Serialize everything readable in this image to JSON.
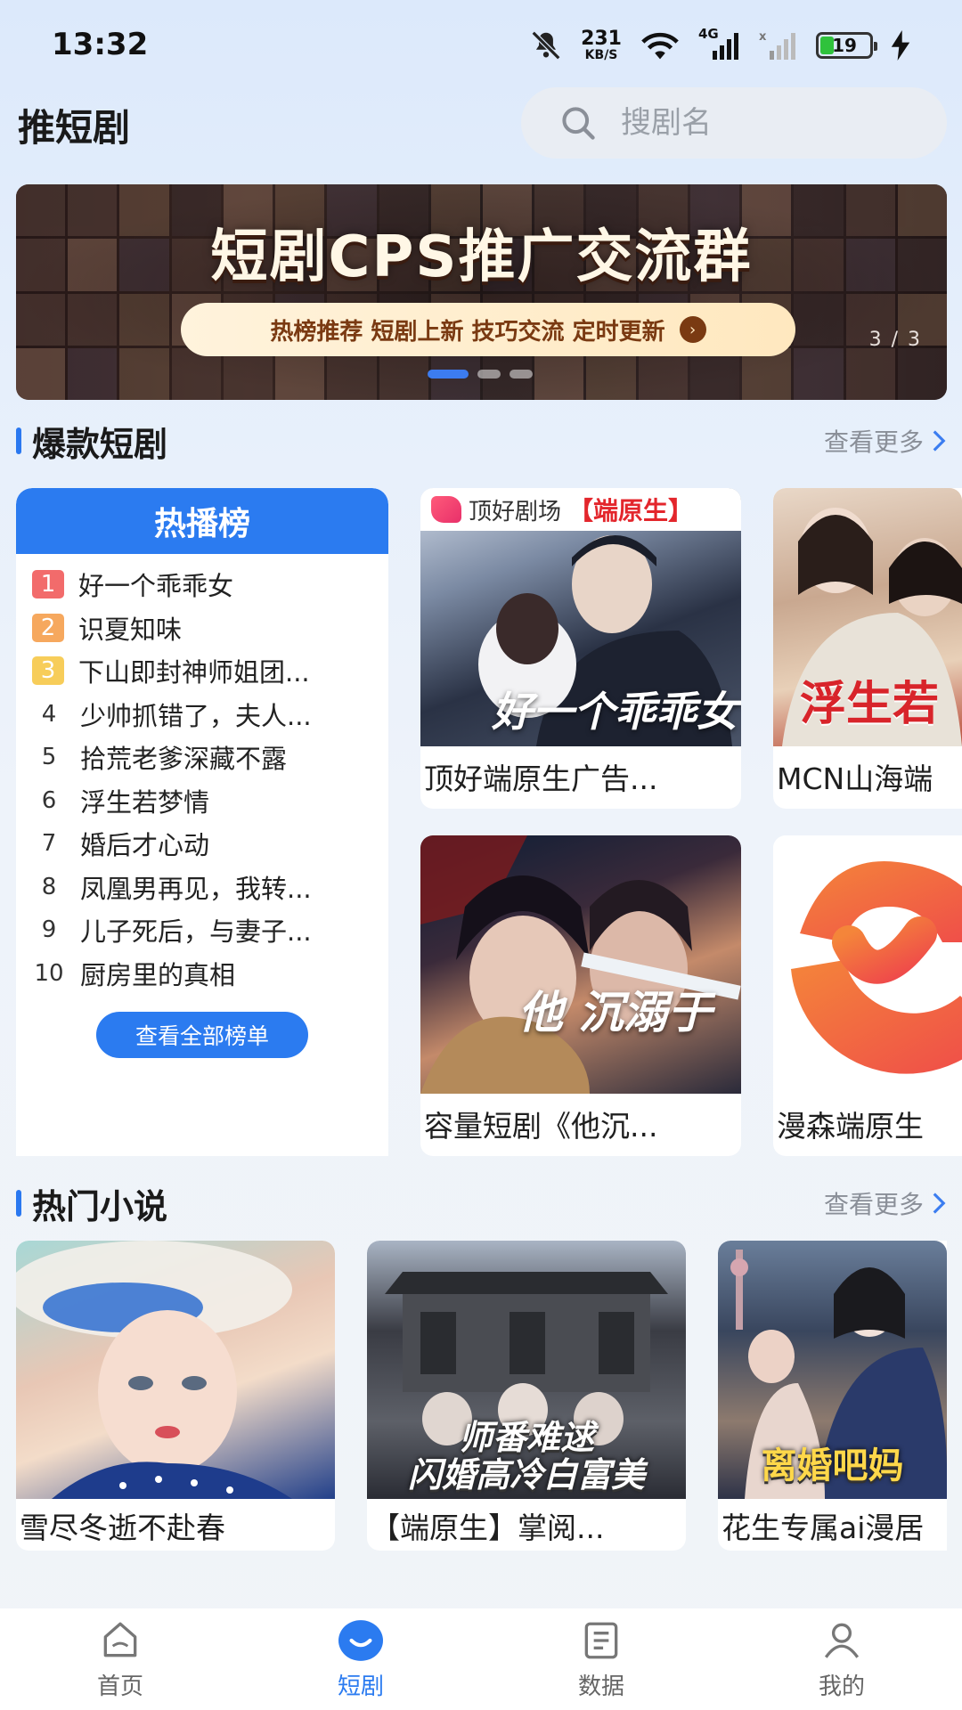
{
  "status_bar": {
    "time": "13:32",
    "net_speed_value": "231",
    "net_speed_unit": "KB/S",
    "network_label": "4G",
    "battery_level": "19",
    "icons": [
      "mute-bell-icon",
      "wifi-icon",
      "signal-4g-icon",
      "signal-sim2-icon",
      "battery-icon",
      "charging-icon"
    ]
  },
  "header": {
    "title": "推短剧",
    "search_placeholder": "搜剧名"
  },
  "banner": {
    "title": "短剧CPS推广交流群",
    "subtitle": "热榜推荐 短剧上新 技巧交流 定时更新",
    "counter": "3 / 3",
    "active_slide": 3,
    "total_slides": 3
  },
  "section_drama": {
    "title": "爆款短剧",
    "more": "查看更多"
  },
  "hot_list": {
    "title": "热播榜",
    "items": [
      {
        "rank": "1",
        "name": "好一个乖乖女"
      },
      {
        "rank": "2",
        "name": "识夏知味"
      },
      {
        "rank": "3",
        "name": "下山即封神师姐团..."
      },
      {
        "rank": "4",
        "name": "少帅抓错了，夫人..."
      },
      {
        "rank": "5",
        "name": "拾荒老爹深藏不露"
      },
      {
        "rank": "6",
        "name": "浮生若梦情"
      },
      {
        "rank": "7",
        "name": "婚后才心动"
      },
      {
        "rank": "8",
        "name": "凤凰男再见，我转..."
      },
      {
        "rank": "9",
        "name": "儿子死后，与妻子..."
      },
      {
        "rank": "10",
        "name": "厨房里的真相"
      }
    ],
    "view_all": "查看全部榜单"
  },
  "drama_cards": [
    {
      "title": "顶好端原生广告...",
      "cover_brand": "顶好剧场",
      "cover_tag": "【端原生】",
      "cover_script": "好一个乖乖女"
    },
    {
      "title": "MCN山海端",
      "cover_script": "浮生若"
    },
    {
      "title": "容量短剧《他沉...",
      "cover_script": "他 沉溺于"
    },
    {
      "title": "漫森端原生"
    }
  ],
  "section_novel": {
    "title": "热门小说",
    "more": "查看更多"
  },
  "novel_cards": [
    {
      "title": "雪尽冬逝不赴春"
    },
    {
      "title": "【端原生】掌阅...",
      "cover_caption_1": "师番难逑",
      "cover_caption_2": "闪婚高冷白富美"
    },
    {
      "title": "花生专属ai漫居",
      "cover_caption_1": "离婚吧妈"
    }
  ],
  "bottom_nav": [
    {
      "label": "首页",
      "icon": "home-icon",
      "active": false
    },
    {
      "label": "短剧",
      "icon": "drama-icon",
      "active": true
    },
    {
      "label": "数据",
      "icon": "data-icon",
      "active": false
    },
    {
      "label": "我的",
      "icon": "profile-icon",
      "active": false
    }
  ],
  "colors": {
    "accent": "#2b7bf0",
    "rank1": "#f26b6b",
    "rank2": "#f6a85e",
    "rank3": "#f7cd5a"
  }
}
